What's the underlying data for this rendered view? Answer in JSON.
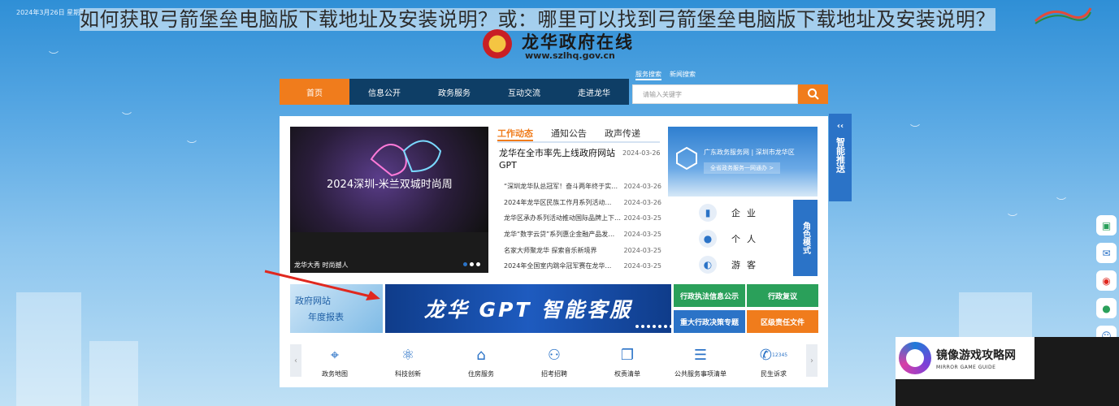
{
  "top_bar": {
    "date": "2024年3月26日 星期二"
  },
  "overlay_title": {
    "part1": "如何获取弓箭堡垒电脑版下载地址及安装说明？或：哪里可以找到弓箭堡垒电脑版下载地址及安装说明？"
  },
  "site": {
    "name": "龙华政府在线",
    "url": "www.szlhq.gov.cn"
  },
  "nav": {
    "items": [
      "首页",
      "信息公开",
      "政务服务",
      "互动交流",
      "走进龙华"
    ]
  },
  "search": {
    "tabs": [
      "服务搜索",
      "新闻搜索"
    ],
    "placeholder": "请输入关键字"
  },
  "carousel": {
    "caption": "龙华大秀 时尚撼人",
    "image_text": "2024深圳-米兰双城时尚周"
  },
  "news": {
    "tabs": [
      "工作动态",
      "通知公告",
      "政声传递"
    ],
    "headline": {
      "title": "龙华在全市率先上线政府网站GPT",
      "date": "2024-03-26"
    },
    "items": [
      {
        "title": "“深圳龙华队总冠军！奋斗两年终于实…",
        "date": "2024-03-26"
      },
      {
        "title": "2024年龙华区民族工作月系列活动…",
        "date": "2024-03-26"
      },
      {
        "title": "龙华区承办系列活动推动国际品牌上下…",
        "date": "2024-03-25"
      },
      {
        "title": "龙华“数字云贷”系列惠企金融产品发…",
        "date": "2024-03-25"
      },
      {
        "title": "名家大师聚龙华 探索音乐新境界",
        "date": "2024-03-25"
      },
      {
        "title": "2024年全国室内跳伞冠军赛在龙华…",
        "date": "2024-03-25"
      }
    ]
  },
  "gov_banner": {
    "title": "广东政务服务网 | 深圳市龙华区",
    "button": "全省政务服务一网通办 >"
  },
  "roles": {
    "items": [
      "企业",
      "个人",
      "游客"
    ],
    "tag": "角色模式"
  },
  "side_push": {
    "label": "智能推送"
  },
  "annual_report": {
    "line1": "政府网站",
    "line2": "年度报表"
  },
  "gpt_banner": {
    "text": "龙华 GPT 智能客服"
  },
  "quick_links": [
    {
      "label": "行政执法信息公示",
      "color": "#2aa05a"
    },
    {
      "label": "行政复议",
      "color": "#2aa05a"
    },
    {
      "label": "重大行政决策专题",
      "color": "#2b73c7"
    },
    {
      "label": "区级责任文件",
      "color": "#f07c1c"
    }
  ],
  "services": [
    {
      "label": "政务地图",
      "icon": "map-pin-icon"
    },
    {
      "label": "科技创新",
      "icon": "atom-icon"
    },
    {
      "label": "住房服务",
      "icon": "house-icon"
    },
    {
      "label": "招考招聘",
      "icon": "people-icon"
    },
    {
      "label": "权责清单",
      "icon": "documents-icon"
    },
    {
      "label": "公共服务事项清单",
      "icon": "list-icon"
    },
    {
      "label": "民生诉求",
      "icon": "phone-icon"
    }
  ],
  "service_hotline": "12345",
  "right_icons": [
    "app-icon",
    "wechat-work-icon",
    "weibo-icon",
    "wechat-icon",
    "robot-icon"
  ],
  "watermark": {
    "title": "镜像游戏攻略网",
    "subtitle": "MIRROR GAME GUIDE"
  },
  "colors": {
    "primary_blue": "#2b73c7",
    "nav_dark": "#0e3e66",
    "accent_orange": "#f07c1c",
    "green": "#2aa05a"
  }
}
